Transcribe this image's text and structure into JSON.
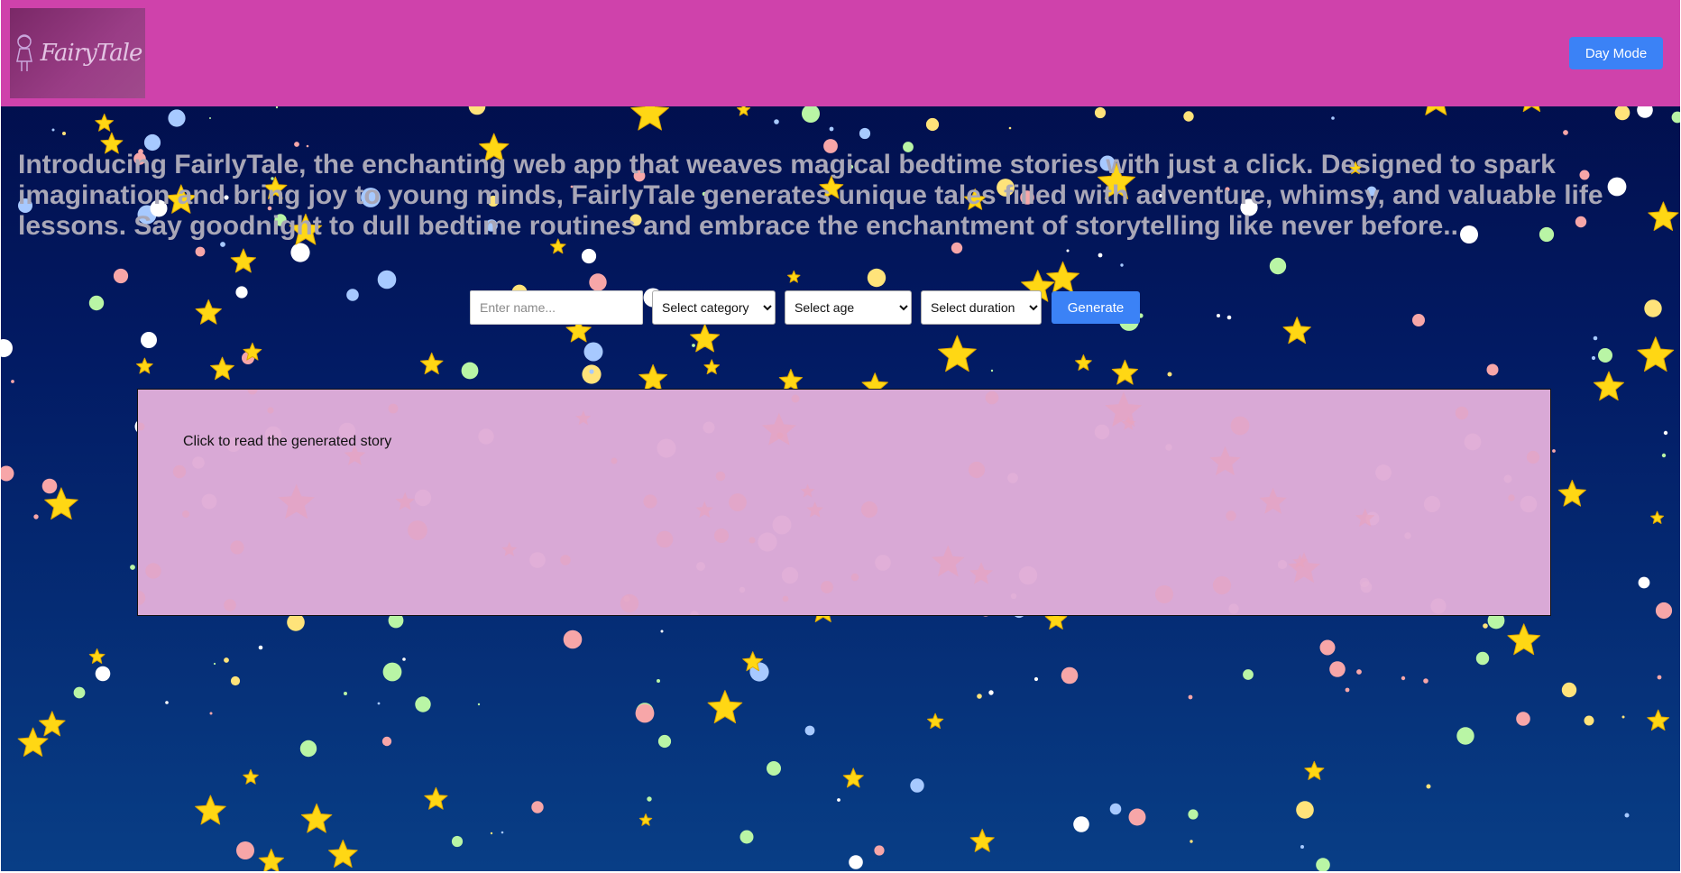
{
  "header": {
    "logo_text": "FairyTale",
    "mode_button": "Day Mode"
  },
  "intro": "Introducing FairlyTale, the enchanting web app that weaves magical bedtime stories with just a click. Designed to spark imagination and bring joy to young minds, FairlyTale generates unique tales filled with adventure, whimsy, and valuable life lessons. Say goodnight to dull bedtime routines and embrace the enchantment of storytelling like never before..",
  "form": {
    "name_placeholder": "Enter name...",
    "category_selected": "Select category",
    "age_selected": "Select age",
    "duration_selected": "Select duration",
    "generate_label": "Generate"
  },
  "story": {
    "prompt": "Click to read the generated story"
  },
  "colors": {
    "header_bg": "#cf42ab",
    "sky_top": "#010b45",
    "sky_bottom": "#083e86",
    "button_blue": "#3b82f6",
    "story_bg": "#d9a9d6",
    "star_yellow": "#ffd714",
    "intro_text": "#a9a7b7"
  },
  "icons": {
    "logo": "fairy-girl-icon",
    "decor": "star-icon"
  }
}
